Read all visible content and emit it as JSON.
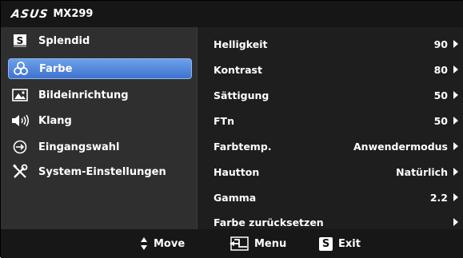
{
  "title": {
    "brand": "ASUS",
    "model": "MX299"
  },
  "sidebar": {
    "items": [
      {
        "label": "Splendid",
        "icon": "splendid-s-icon"
      },
      {
        "label": "Farbe",
        "icon": "color-palette-icon",
        "selected": true
      },
      {
        "label": "Bildeinrichtung",
        "icon": "image-icon"
      },
      {
        "label": "Klang",
        "icon": "speaker-icon"
      },
      {
        "label": "Eingangswahl",
        "icon": "input-icon"
      },
      {
        "label": "System-Einstellungen",
        "icon": "tools-icon"
      }
    ]
  },
  "menu": {
    "rows": [
      {
        "label": "Helligkeit",
        "value": "90"
      },
      {
        "label": "Kontrast",
        "value": "80"
      },
      {
        "label": "Sättigung",
        "value": "50"
      },
      {
        "label": "FTn",
        "value": "50"
      },
      {
        "label": "Farbtemp.",
        "value": "Anwendermodus"
      },
      {
        "label": "Hautton",
        "value": "Natürlich"
      },
      {
        "label": "Gamma",
        "value": "2.2"
      },
      {
        "label": "Farbe zurücksetzen",
        "value": ""
      }
    ]
  },
  "footer": {
    "move_label": "Move",
    "menu_label": "Menu",
    "exit_label": "Exit",
    "exit_key": "S"
  },
  "colors": {
    "selected_bg": "#4f86dd",
    "sidebar_bg": "#2f2f2f",
    "main_bg": "#1e1e1e"
  }
}
